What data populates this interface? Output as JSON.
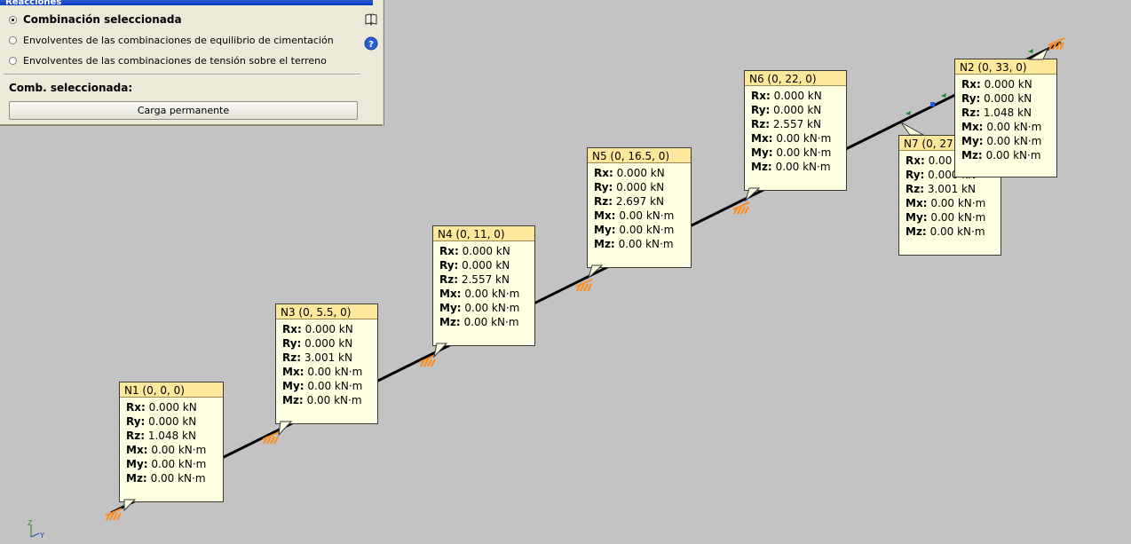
{
  "panel": {
    "title": "Reacciones",
    "options": [
      {
        "label": "Combinación seleccionada",
        "checked": true
      },
      {
        "label": "Envolventes de las combinaciones de equilibrio de cimentación",
        "checked": false
      },
      {
        "label": "Envolventes de las combinaciones de tensión sobre el terreno",
        "checked": false
      }
    ],
    "comb_label": "Comb. seleccionada:",
    "comb_button": "Carga permanente",
    "icons": [
      "book-icon",
      "help-icon"
    ]
  },
  "nodes": [
    {
      "title": "N1 (0, 0, 0)",
      "rx": "0.000 kN",
      "ry": "0.000 kN",
      "rz": "1.048 kN",
      "mx": "0.00 kN·m",
      "my": "0.00 kN·m",
      "mz": "0.00 kN·m"
    },
    {
      "title": "N3 (0, 5.5, 0)",
      "rx": "0.000 kN",
      "ry": "0.000 kN",
      "rz": "3.001 kN",
      "mx": "0.00 kN·m",
      "my": "0.00 kN·m",
      "mz": "0.00 kN·m"
    },
    {
      "title": "N4 (0, 11, 0)",
      "rx": "0.000 kN",
      "ry": "0.000 kN",
      "rz": "2.557 kN",
      "mx": "0.00 kN·m",
      "my": "0.00 kN·m",
      "mz": "0.00 kN·m"
    },
    {
      "title": "N5 (0, 16.5, 0)",
      "rx": "0.000 kN",
      "ry": "0.000 kN",
      "rz": "2.697 kN",
      "mx": "0.00 kN·m",
      "my": "0.00 kN·m",
      "mz": "0.00 kN·m"
    },
    {
      "title": "N6 (0, 22, 0)",
      "rx": "0.000 kN",
      "ry": "0.000 kN",
      "rz": "2.557 kN",
      "mx": "0.00 kN·m",
      "my": "0.00 kN·m",
      "mz": "0.00 kN·m"
    },
    {
      "title": "N7 (0, 27",
      "rx": "0.00",
      "ry": "0.000 kN",
      "rz": "3.001 kN",
      "mx": "0.00 kN·m",
      "my": "0.00 kN·m",
      "mz": "0.00 kN·m"
    },
    {
      "title": "N2 (0, 33, 0)",
      "rx": "0.000 kN",
      "ry": "0.000 kN",
      "rz": "1.048 kN",
      "mx": "0.00 kN·m",
      "my": "0.00 kN·m",
      "mz": "0.00 kN·m"
    }
  ],
  "axes": {
    "z": "Z",
    "y": "Y"
  },
  "colors": {
    "background": "#c3c3c3",
    "label_fill": "#ffffe1",
    "label_header": "#fde79a",
    "support": "#ff8a1e",
    "beam": "#000000",
    "node_marker": "#1f8a2a"
  }
}
